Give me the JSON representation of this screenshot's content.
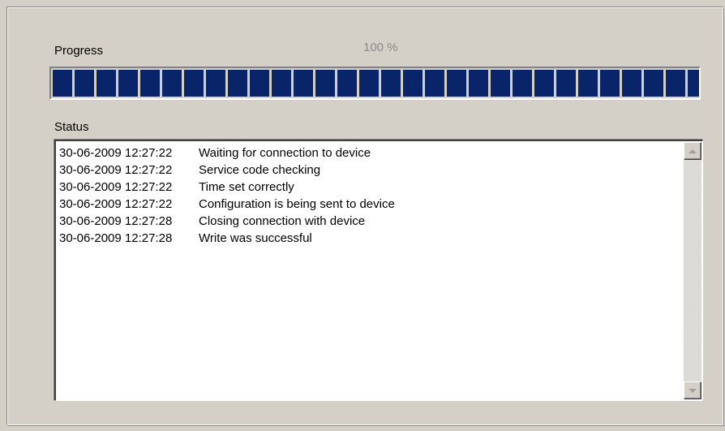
{
  "progress": {
    "label": "Progress",
    "percent_text": "100 %",
    "value": 1.0,
    "fill_color": "#0a246a"
  },
  "status": {
    "label": "Status",
    "entries": [
      {
        "time": "30-06-2009 12:27:22",
        "message": "Waiting for connection to device"
      },
      {
        "time": "30-06-2009 12:27:22",
        "message": "Service code checking"
      },
      {
        "time": "30-06-2009 12:27:22",
        "message": "Time set correctly"
      },
      {
        "time": "30-06-2009 12:27:22",
        "message": "Configuration is being sent to device"
      },
      {
        "time": "30-06-2009 12:27:28",
        "message": "Closing connection with device"
      },
      {
        "time": "30-06-2009 12:27:28",
        "message": "Write was successful"
      }
    ]
  },
  "scrollbar": {
    "up_icon": "arrow-up-icon",
    "down_icon": "arrow-down-icon"
  }
}
